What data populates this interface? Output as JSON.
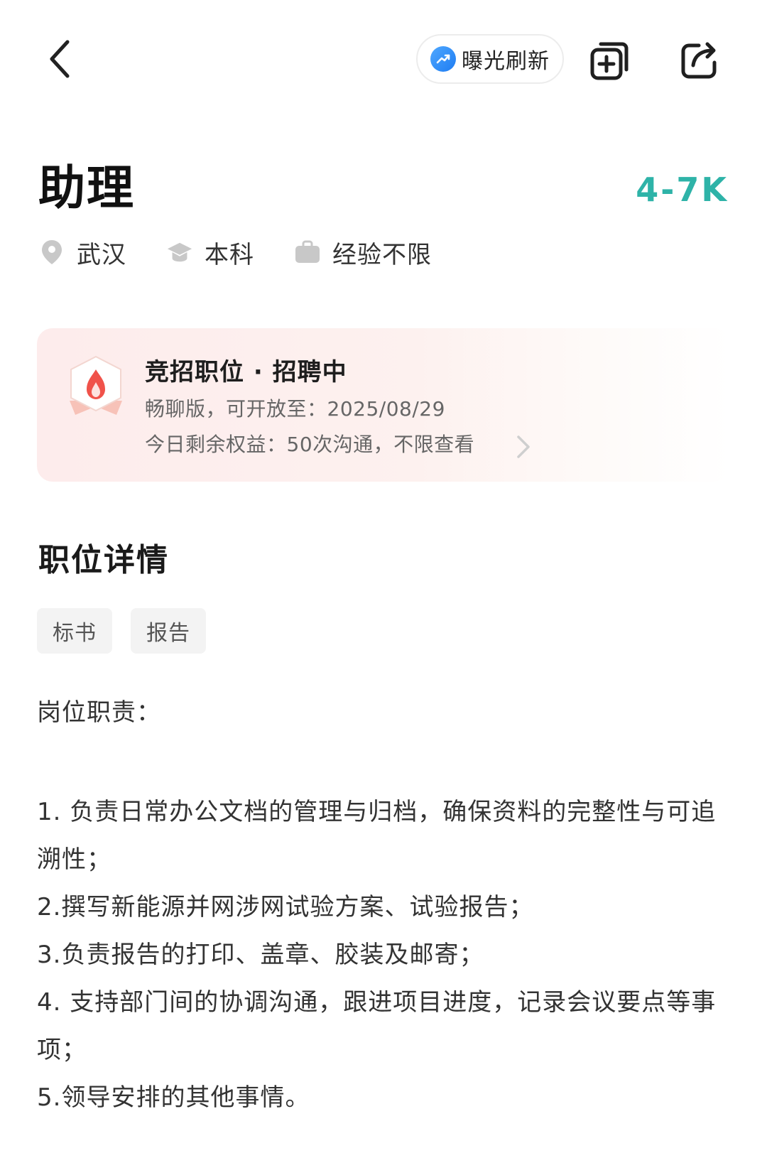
{
  "header": {
    "boost_label": "曝光刷新"
  },
  "job": {
    "title": "助理",
    "salary": "4-7K",
    "city": "武汉",
    "education": "本科",
    "experience": "经验不限"
  },
  "promo": {
    "title": "竞招职位 · 招聘中",
    "line1": "畅聊版，可开放至：2025/08/29",
    "line2": "今日剩余权益：50次沟通，不限查看"
  },
  "details": {
    "section_title": "职位详情",
    "tags": [
      "标书",
      "报告"
    ],
    "duty_heading": "岗位职责：",
    "duties": [
      "1. 负责日常办公文档的管理与归档，确保资料的完整性与可追溯性；",
      "2.撰写新能源并网涉网试验方案、试验报告；",
      "3.负责报告的打印、盖章、胶装及邮寄；",
      "4. 支持部门间的协调沟通，跟进项目进度，记录会议要点等事项；",
      "5.领导安排的其他事情。"
    ]
  },
  "colors": {
    "salary": "#2eb3a8",
    "promo_bg": "#fdecec",
    "boost_icon": "#1e7cf2"
  },
  "icons": {
    "back": "chevron-left-icon",
    "boost": "chart-up-icon",
    "add": "add-copy-icon",
    "share": "share-icon",
    "location": "location-pin-icon",
    "education": "graduation-cap-icon",
    "experience": "briefcase-icon",
    "promo": "flame-badge-icon"
  }
}
